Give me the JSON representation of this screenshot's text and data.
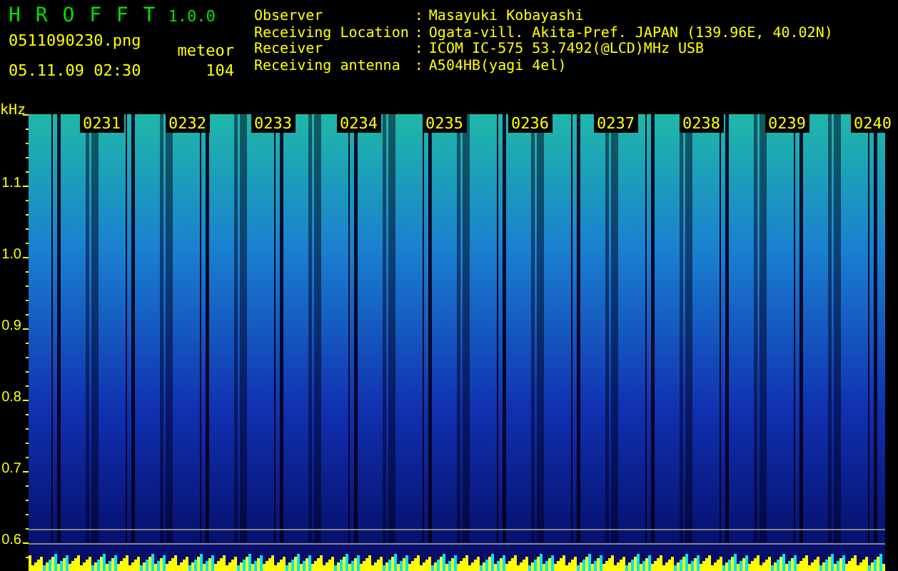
{
  "app": {
    "title": "H R O F F T",
    "version": "1.0.0"
  },
  "file": "0511090230.png",
  "datetime": "05.11.09 02:30",
  "meteor": {
    "label": "meteor",
    "count": "104"
  },
  "info": [
    {
      "label": "Observer",
      "separator": ":",
      "value": "Masayuki Kobayashi"
    },
    {
      "label": "Receiving Location",
      "separator": ":",
      "value": "Ogata-vill. Akita-Pref. JAPAN (139.96E, 40.02N)"
    },
    {
      "label": "Receiver",
      "separator": ":",
      "value": "ICOM IC-575 53.7492(@LCD)MHz USB"
    },
    {
      "label": "Receiving antenna",
      "separator": ":",
      "value": "A504HB(yagi 4el)"
    }
  ],
  "plot": {
    "y_unit": "kHz",
    "y_labels": [
      "1.1",
      "1.0",
      "0.9",
      "0.8",
      "0.7",
      "0.6"
    ],
    "time_labels": [
      "0231",
      "0232",
      "0233",
      "0234",
      "0235",
      "0236",
      "0237",
      "0238",
      "0239",
      "0240"
    ]
  }
}
